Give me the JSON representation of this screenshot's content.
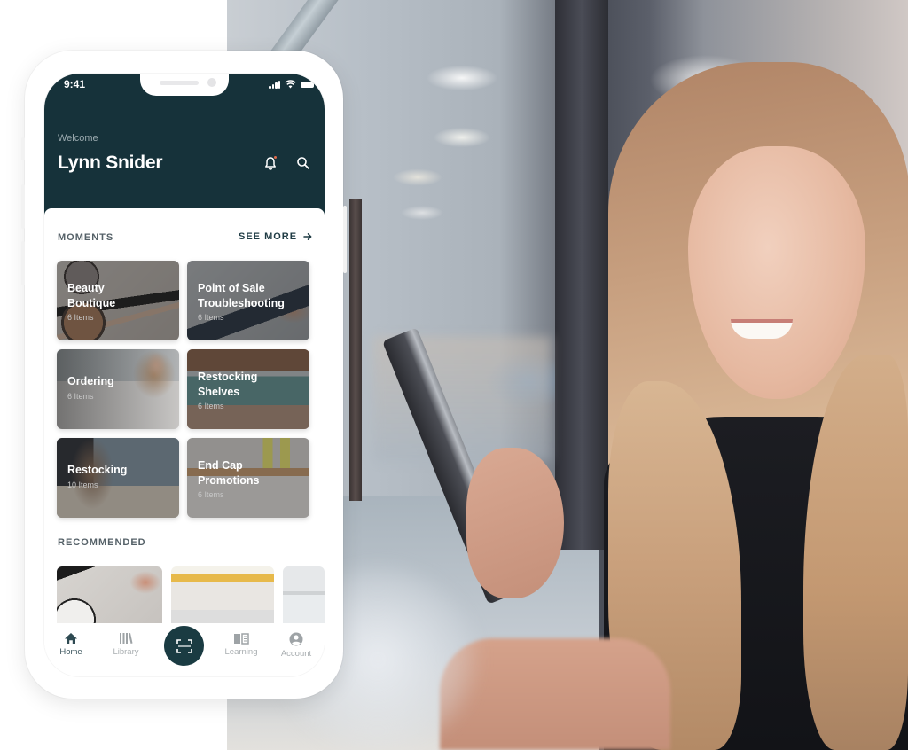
{
  "status_bar": {
    "time": "9:41"
  },
  "header": {
    "greeting": "Welcome",
    "user_name": "Lynn Snider",
    "notification_icon": "bell-icon",
    "search_icon": "search-icon"
  },
  "moments": {
    "title": "MOMENTS",
    "see_more_label": "SEE MORE",
    "see_more_icon": "arrow-right-icon",
    "items": [
      {
        "title": "Beauty\nBoutique",
        "title_line1": "Beauty",
        "title_line2": "Boutique",
        "count": "6 Items"
      },
      {
        "title": "Point of Sale Troubleshooting",
        "title_line1": "Point of Sale",
        "title_line2": "Troubleshooting",
        "count": "6 Items"
      },
      {
        "title": "Ordering",
        "title_line1": "Ordering",
        "title_line2": "",
        "count": "6 Items"
      },
      {
        "title": "Restocking Shelves",
        "title_line1": "Restocking",
        "title_line2": "Shelves",
        "count": "6 Items"
      },
      {
        "title": "Restocking",
        "title_line1": "Restocking",
        "title_line2": "",
        "count": "10 Items"
      },
      {
        "title": "End Cap Promotions",
        "title_line1": "End Cap",
        "title_line2": "Promotions",
        "count": "6 Items"
      }
    ]
  },
  "recommended": {
    "title": "RECOMMENDED",
    "items": [
      {
        "image": "makeup-flatlay-image"
      },
      {
        "image": "store-shelf-image"
      },
      {
        "image": "pharmacy-shelf-image"
      }
    ]
  },
  "tab_bar": {
    "items": [
      {
        "label": "Home",
        "icon": "home-icon",
        "active": true
      },
      {
        "label": "Library",
        "icon": "library-icon",
        "active": false
      },
      {
        "label": "",
        "icon": "scan-icon",
        "active": false
      },
      {
        "label": "Learning",
        "icon": "book-icon",
        "active": false
      },
      {
        "label": "Account",
        "icon": "account-icon",
        "active": false
      }
    ]
  },
  "colors": {
    "header_bg": "#16323a",
    "accent": "#1a3b42",
    "notification_dot": "#e06b4b",
    "section_title": "#556168",
    "tab_inactive": "#a9aeb1"
  }
}
